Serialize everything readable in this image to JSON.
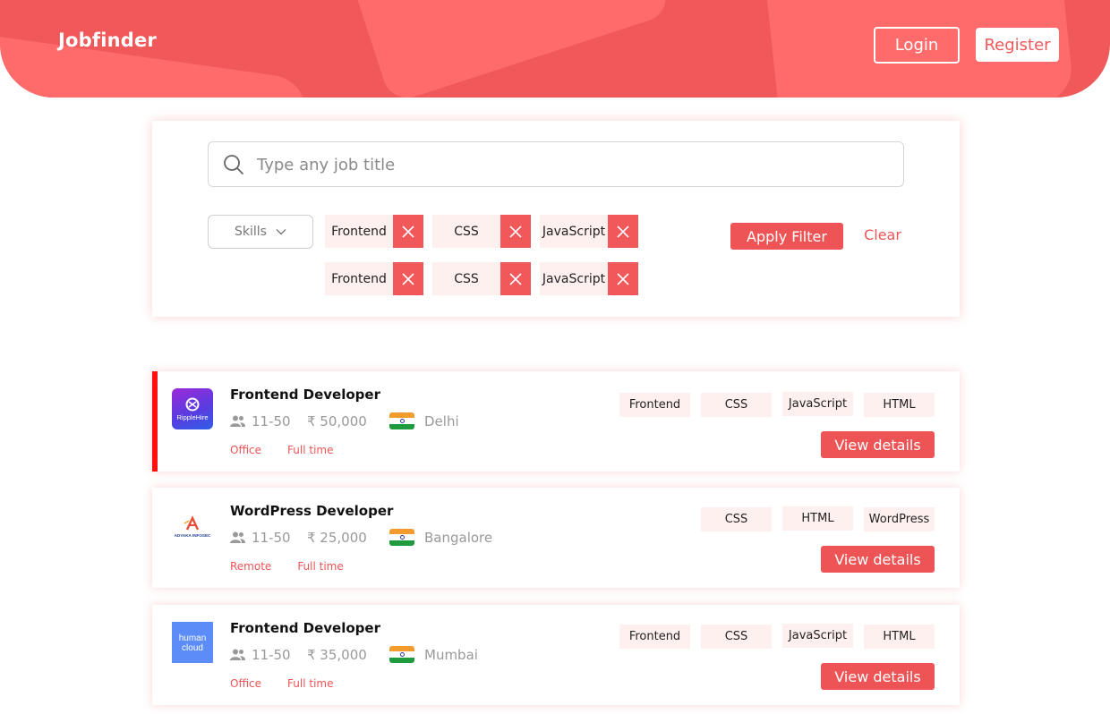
{
  "header": {
    "logo": "Jobfinder",
    "login_label": "Login",
    "register_label": "Register",
    "color": "#f0585a"
  },
  "filter": {
    "search_placeholder": "Type any job title",
    "skills_dropdown_label": "Skills",
    "selected_skills_row1": [
      "Frontend",
      "CSS",
      "JavaScript"
    ],
    "selected_skills_row2": [
      "Frontend",
      "CSS",
      "JavaScript"
    ],
    "apply_label": "Apply Filter",
    "clear_label": "Clear"
  },
  "jobs": [
    {
      "title": "Frontend Developer",
      "company_logo": "RippleHire",
      "company_size": "11-50",
      "salary": "₹ 50,000",
      "location": "Delhi",
      "work_mode": "Office",
      "job_type": "Full time",
      "skills": [
        "Frontend",
        "CSS",
        "JavaScript",
        "HTML"
      ],
      "view_label": "View details",
      "selected": true
    },
    {
      "title": "WordPress Developer",
      "company_logo": "ADYAKA INFOSEC",
      "company_size": "11-50",
      "salary": "₹ 25,000",
      "location": "Bangalore",
      "work_mode": "Remote",
      "job_type": "Full time",
      "skills": [
        "CSS",
        "HTML",
        "WordPress"
      ],
      "view_label": "View details",
      "selected": false
    },
    {
      "title": "Frontend Developer",
      "company_logo": "human cloud",
      "company_size": "11-50",
      "salary": "₹ 35,000",
      "location": "Mumbai",
      "work_mode": "Office",
      "job_type": "Full time",
      "skills": [
        "Frontend",
        "CSS",
        "JavaScript",
        "HTML"
      ],
      "view_label": "View details",
      "selected": false
    }
  ],
  "icons": {
    "search": "search-icon",
    "chevron": "chevron-down-icon",
    "remove": "close-icon",
    "company_size": "people-icon",
    "location": "india-flag-icon"
  }
}
